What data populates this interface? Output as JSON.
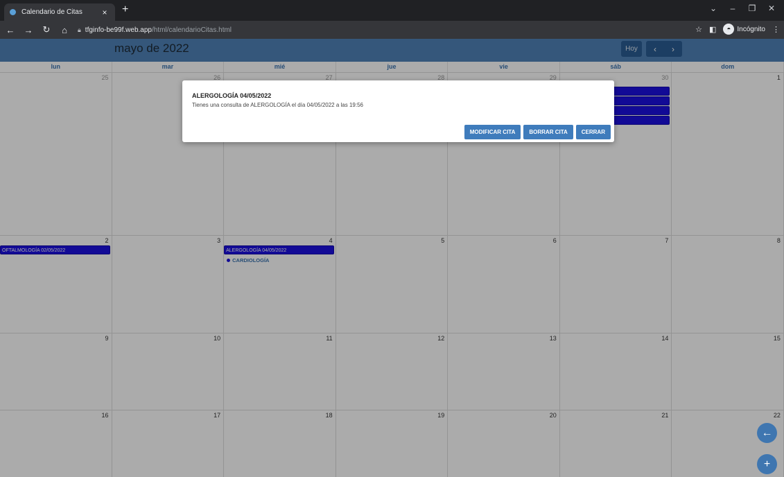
{
  "browser": {
    "tab_title": "Calendario de Citas",
    "tab_close": "×",
    "new_tab": "+",
    "url_host": "tfginfo-be99f.web.app",
    "url_path": "/html/calendarioCitas.html",
    "incognito_label": "Incógnito"
  },
  "calendar": {
    "title": "mayo de 2022",
    "today_label": "Hoy",
    "prev_label": "‹",
    "next_label": "›",
    "weekdays": [
      "lun",
      "mar",
      "mié",
      "jue",
      "vie",
      "sáb",
      "dom"
    ],
    "weeks": [
      {
        "days": [
          {
            "num": "25",
            "other": true,
            "events": []
          },
          {
            "num": "26",
            "other": true,
            "events": []
          },
          {
            "num": "27",
            "other": true,
            "events": []
          },
          {
            "num": "28",
            "other": true,
            "events": []
          },
          {
            "num": "29",
            "other": true,
            "events": []
          },
          {
            "num": "30",
            "other": true,
            "events": [
              "0/04/2022",
              "2022",
              "ULAR 30/04/2022",
              "O 30/04/2022"
            ]
          },
          {
            "num": "1",
            "other": false,
            "events": []
          }
        ]
      },
      {
        "days": [
          {
            "num": "2",
            "other": false,
            "events": [
              "OFTALMOLOGÍA 02/05/2022"
            ]
          },
          {
            "num": "3",
            "other": false,
            "events": []
          },
          {
            "num": "4",
            "other": false,
            "events": [
              "ALERGOLOGÍA 04/05/2022"
            ],
            "dot_event": "CARDIOLOGÍA"
          },
          {
            "num": "5",
            "other": false,
            "events": []
          },
          {
            "num": "6",
            "other": false,
            "events": []
          },
          {
            "num": "7",
            "other": false,
            "events": []
          },
          {
            "num": "8",
            "other": false,
            "events": []
          }
        ]
      },
      {
        "days": [
          {
            "num": "9"
          },
          {
            "num": "10"
          },
          {
            "num": "11"
          },
          {
            "num": "12"
          },
          {
            "num": "13"
          },
          {
            "num": "14"
          },
          {
            "num": "15"
          }
        ]
      },
      {
        "days": [
          {
            "num": "16"
          },
          {
            "num": "17"
          },
          {
            "num": "18"
          },
          {
            "num": "19"
          },
          {
            "num": "20"
          },
          {
            "num": "21"
          },
          {
            "num": "22"
          }
        ]
      }
    ]
  },
  "modal": {
    "title": "ALERGOLOGÍA 04/05/2022",
    "body": "Tienes una consulta de ALERGOLOGÍA el día 04/05/2022 a las 19:56",
    "buttons": {
      "modify": "MODIFICAR CITA",
      "delete": "BORRAR CITA",
      "close": "CERRAR"
    }
  },
  "fabs": {
    "back_icon": "arrow-left-icon",
    "add_icon": "plus-icon"
  },
  "colors": {
    "header": "#4f82b8",
    "event": "#1c10e0",
    "button": "#3f7cbc"
  }
}
